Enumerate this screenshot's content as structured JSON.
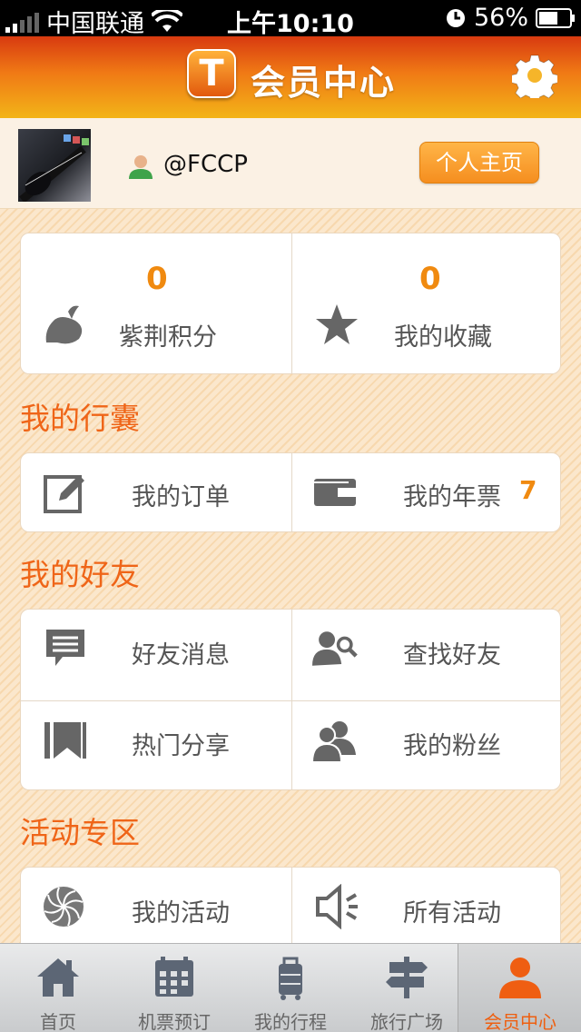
{
  "status_bar": {
    "carrier": "中国联通",
    "time": "上午10:10",
    "battery": "56%"
  },
  "header": {
    "logo_letter": "T",
    "title": "会员中心"
  },
  "profile": {
    "username": "@FCCP",
    "home_button": "个人主页"
  },
  "stats": [
    {
      "value": "0",
      "label": "紫荆积分",
      "icon": "leaf-icon"
    },
    {
      "value": "0",
      "label": "我的收藏",
      "icon": "star-icon"
    }
  ],
  "sections": {
    "bag": {
      "title": "我的行囊",
      "items": [
        {
          "label": "我的订单",
          "icon": "edit-icon"
        },
        {
          "label": "我的年票",
          "icon": "wallet-icon",
          "badge": "7"
        }
      ]
    },
    "friends": {
      "title": "我的好友",
      "items": [
        {
          "label": "好友消息",
          "icon": "message-icon"
        },
        {
          "label": "查找好友",
          "icon": "find-user-icon"
        },
        {
          "label": "热门分享",
          "icon": "bookmark-icon"
        },
        {
          "label": "我的粉丝",
          "icon": "users-icon"
        }
      ]
    },
    "activity": {
      "title": "活动专区",
      "items": [
        {
          "label": "我的活动",
          "icon": "pinwheel-icon"
        },
        {
          "label": "所有活动",
          "icon": "speaker-icon"
        }
      ]
    }
  },
  "tabbar": [
    {
      "label": "首页",
      "icon": "home-icon"
    },
    {
      "label": "机票预订",
      "icon": "calendar-icon"
    },
    {
      "label": "我的行程",
      "icon": "luggage-icon"
    },
    {
      "label": "旅行广场",
      "icon": "signpost-icon"
    },
    {
      "label": "会员中心",
      "icon": "member-icon",
      "active": true
    }
  ],
  "colors": {
    "accent": "#f08a10",
    "section_title": "#ef6518",
    "header_top": "#d83a10",
    "header_bottom": "#f3b418"
  }
}
